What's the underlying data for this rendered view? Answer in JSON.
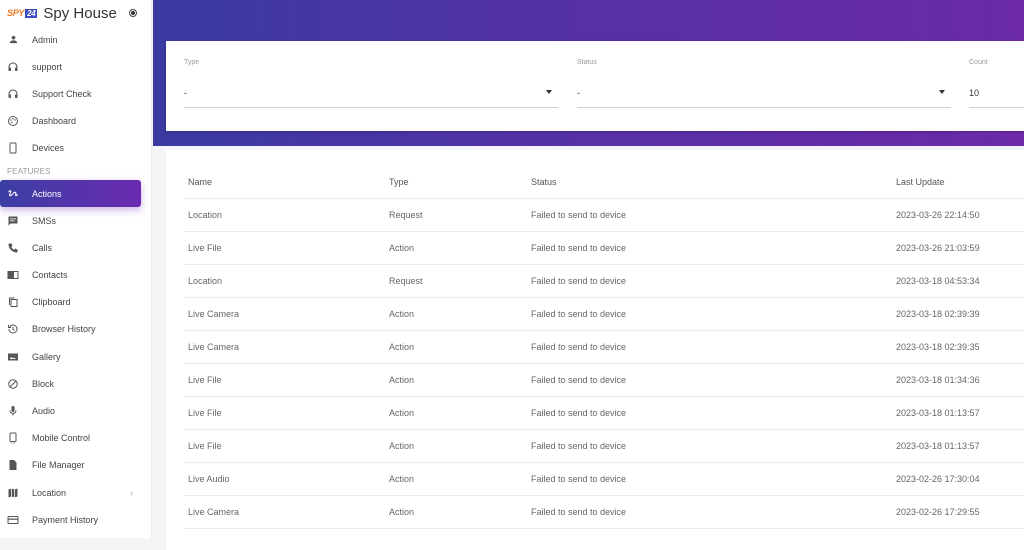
{
  "brand": {
    "logo_part1": "SPY",
    "logo_part2": "24",
    "name": "Spy House"
  },
  "sidebar": {
    "top_items": [
      {
        "label": "Admin",
        "icon": "person-icon"
      },
      {
        "label": "support",
        "icon": "headset-icon"
      },
      {
        "label": "Support Check",
        "icon": "headset-icon"
      },
      {
        "label": "Dashboard",
        "icon": "palette-icon"
      },
      {
        "label": "Devices",
        "icon": "phone-icon"
      }
    ],
    "section_label": "FEATURES",
    "feature_items": [
      {
        "label": "Actions",
        "icon": "gesture-icon",
        "active": true
      },
      {
        "label": "SMSs",
        "icon": "message-icon"
      },
      {
        "label": "Calls",
        "icon": "phone-call-icon"
      },
      {
        "label": "Contacts",
        "icon": "contacts-book-icon"
      },
      {
        "label": "Clipboard",
        "icon": "copy-icon"
      },
      {
        "label": "Browser History",
        "icon": "history-icon"
      },
      {
        "label": "Gallery",
        "icon": "image-icon"
      },
      {
        "label": "Block",
        "icon": "block-icon"
      },
      {
        "label": "Audio",
        "icon": "microphone-icon"
      },
      {
        "label": "Mobile Control",
        "icon": "mobile-control-icon"
      },
      {
        "label": "File Manager",
        "icon": "file-icon"
      },
      {
        "label": "Location",
        "icon": "map-icon",
        "has_submenu": true
      },
      {
        "label": "Payment History",
        "icon": "credit-card-icon"
      }
    ]
  },
  "filters": {
    "type": {
      "label": "Type",
      "value": "-"
    },
    "status": {
      "label": "Status",
      "value": "-"
    },
    "count": {
      "label": "Count",
      "value": "10"
    }
  },
  "table": {
    "columns": [
      "Name",
      "Type",
      "Status",
      "Last Update"
    ],
    "rows": [
      [
        "Location",
        "Request",
        "Failed to send to device",
        "2023-03-26 22:14:50"
      ],
      [
        "Live File",
        "Action",
        "Failed to send to device",
        "2023-03-26 21:03:59"
      ],
      [
        "Location",
        "Request",
        "Failed to send to device",
        "2023-03-18 04:53:34"
      ],
      [
        "Live Camera",
        "Action",
        "Failed to send to device",
        "2023-03-18 02:39:39"
      ],
      [
        "Live Camera",
        "Action",
        "Failed to send to device",
        "2023-03-18 02:39:35"
      ],
      [
        "Live File",
        "Action",
        "Failed to send to device",
        "2023-03-18 01:34:36"
      ],
      [
        "Live File",
        "Action",
        "Failed to send to device",
        "2023-03-18 01:13:57"
      ],
      [
        "Live File",
        "Action",
        "Failed to send to device",
        "2023-03-18 01:13:57"
      ],
      [
        "Live Audio",
        "Action",
        "Failed to send to device",
        "2023-02-26 17:30:04"
      ],
      [
        "Live Camera",
        "Action",
        "Failed to send to device",
        "2023-02-26 17:29:55"
      ]
    ]
  },
  "colors": {
    "accent_start": "#3b3ea4",
    "accent_end": "#6a2bb0",
    "logo_orange": "#f07a2a",
    "logo_blue": "#3c4cc0"
  }
}
